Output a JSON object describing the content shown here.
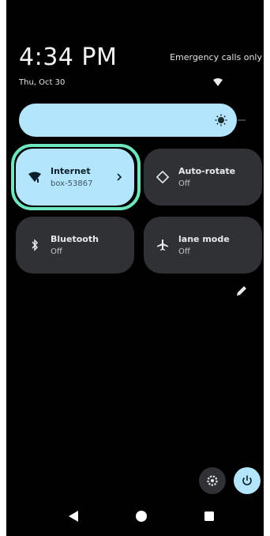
{
  "status": {
    "time": "4:34 PM",
    "emergency_text": "Emergency calls only",
    "date": "Thu, Oct 30"
  },
  "brightness": {
    "level": 1.0
  },
  "tiles": [
    {
      "title": "Internet",
      "subtitle": "box-53867",
      "active": true,
      "icon": "wifi-icon"
    },
    {
      "title": "Auto-rotate",
      "subtitle": "Off",
      "active": false,
      "icon": "rotate-icon"
    },
    {
      "title": "Bluetooth",
      "subtitle": "Off",
      "active": false,
      "icon": "bluetooth-icon"
    },
    {
      "title": "lane mode",
      "subtitle": "Off",
      "active": false,
      "icon": "airplane-icon"
    }
  ],
  "colors": {
    "accent": "#b3e5fc",
    "tile_bg": "#303134",
    "highlight": "#6ee6c0",
    "background": "#000000"
  },
  "icons": {
    "status_wifi": "wifi-status-icon",
    "edit": "pencil-icon",
    "settings": "gear-icon",
    "power": "power-icon",
    "back": "back-triangle-icon",
    "home": "home-circle-icon",
    "recents": "recents-square-icon"
  }
}
